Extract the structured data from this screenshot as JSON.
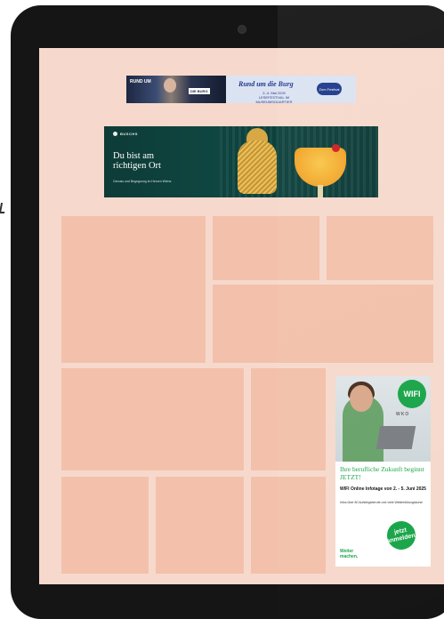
{
  "colors": {
    "device_frame": "#151515",
    "screen_background": "#f6d9cc",
    "placeholder_tile": "#f3c1ab",
    "wifi_green": "#1aa54a"
  },
  "banner_top": {
    "headline": "Rund um die Burg",
    "sub_line_1": "2.-4. Mai 2025",
    "sub_line_2": "LESEFESTIVAL IM MUSEUMSQUARTIER",
    "button_label": "Zum Festival",
    "photo_label": "RUND UM",
    "photo_tag": "DIE BURG"
  },
  "banner_bar": {
    "logo_text": "BUSCHS",
    "headline_line_1": "Du bist am",
    "headline_line_2": "richtigen Ort",
    "subline": "Genuss und Begegnung im Herzen Wiens"
  },
  "tiles": [
    {
      "name": "tile-large-left"
    },
    {
      "name": "tile-small-top-middle"
    },
    {
      "name": "tile-small-top-right"
    },
    {
      "name": "tile-wide-right"
    },
    {
      "name": "tile-wide-bottom-left"
    },
    {
      "name": "tile-narrow-bottom-middle"
    },
    {
      "name": "tile-bottom-1"
    },
    {
      "name": "tile-bottom-2"
    },
    {
      "name": "tile-bottom-3"
    }
  ],
  "wifi_ad": {
    "logo": "WIFI",
    "wko": "WKO",
    "headline": "Ihre berufliche Zukunft beginnt JETZT!",
    "dates": "WIFI Online Infotage von 2. - 5. Juni 2025",
    "fine_print": "Infos über 80 Aufstiegsberufe und viele Weiterbildungskurse",
    "badge_line_1": "jetzt",
    "badge_line_2": "anmelden!",
    "slogan_line_1": "Weiter",
    "slogan_line_2": "machen."
  }
}
